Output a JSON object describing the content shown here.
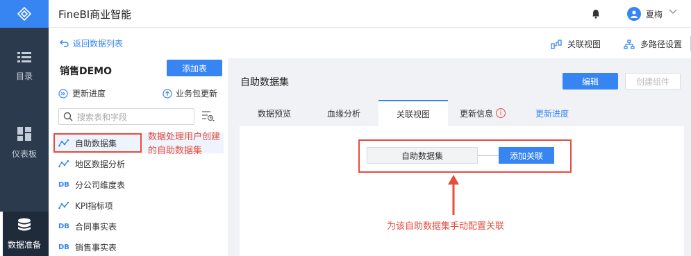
{
  "app": {
    "title": "FineBI商业智能"
  },
  "user": {
    "name": "夏梅"
  },
  "nav": {
    "items": [
      {
        "label": "目录"
      },
      {
        "label": "仪表板"
      },
      {
        "label": "数据准备"
      }
    ]
  },
  "subbar": {
    "back_label": "返回数据列表",
    "relation_view_label": "关联视图",
    "multi_path_label": "多路径设置"
  },
  "left": {
    "package_title": "销售DEMO",
    "add_table_label": "添加表",
    "update_progress_label": "更新进度",
    "package_update_label": "业务包更新",
    "search_placeholder": "搜索表和字段",
    "tables": [
      {
        "name": "自助数据集",
        "type": "selfhelp",
        "tag": ""
      },
      {
        "name": "地区数据分析",
        "type": "selfhelp",
        "tag": ""
      },
      {
        "name": "分公司维度表",
        "type": "db",
        "tag": "DB"
      },
      {
        "name": "KPI指标项",
        "type": "selfhelp",
        "tag": ""
      },
      {
        "name": "合同事实表",
        "type": "db",
        "tag": "DB"
      },
      {
        "name": "销售事实表",
        "type": "db",
        "tag": "DB"
      }
    ]
  },
  "right": {
    "title": "自助数据集",
    "edit_label": "编辑",
    "create_component_label": "创建组件",
    "tabs": [
      {
        "label": "数据预览"
      },
      {
        "label": "血缘分析"
      },
      {
        "label": "关联视图"
      },
      {
        "label": "更新信息"
      },
      {
        "label": "更新进度"
      }
    ],
    "active_tab": "关联视图",
    "node_label": "自助数据集",
    "add_relation_label": "添加关联"
  },
  "annotations": {
    "left_note": "数据处理用户创建\n的自助数据集",
    "bottom_note": "为该自助数据集手动配置关联",
    "color": "#e84c3d"
  },
  "colors": {
    "accent": "#3685f2",
    "nav_bg": "#2b3a4d",
    "annotation": "#e84c3d"
  }
}
